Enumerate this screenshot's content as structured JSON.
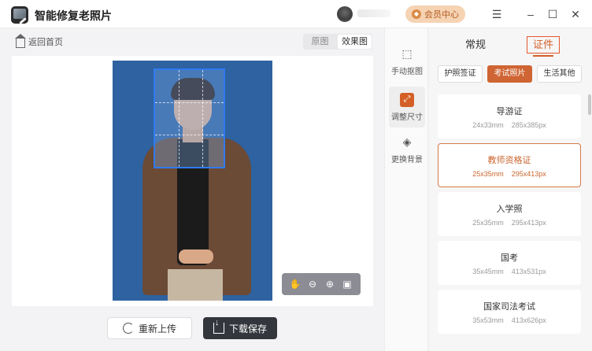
{
  "app": {
    "title": "智能修复老照片"
  },
  "header": {
    "vip_label": "会员中心",
    "vip_icon": "diamond-icon",
    "menu_icon": "hamburger-menu-icon",
    "minimize_icon": "minimize-icon",
    "maximize_icon": "maximize-icon",
    "close_icon": "close-icon"
  },
  "left": {
    "back_label": "返回首页",
    "view_options": [
      "原图",
      "效果图"
    ],
    "active_view": "效果图",
    "zoom_tools": [
      "hand-icon",
      "zoom-out-icon",
      "zoom-in-icon",
      "fit-icon"
    ],
    "reupload_label": "重新上传",
    "download_label": "下载保存"
  },
  "tools": [
    {
      "label": "手动抠图",
      "icon": "cursor-select-icon",
      "active": false
    },
    {
      "label": "调整尺寸",
      "icon": "resize-icon",
      "active": true
    },
    {
      "label": "更换背景",
      "icon": "paint-bucket-icon",
      "active": false
    }
  ],
  "panel": {
    "tabs": [
      "常规",
      "证件"
    ],
    "active_tab": "证件",
    "subtabs": [
      "护照签证",
      "考试照片",
      "生活其他"
    ],
    "active_subtab": "考试照片",
    "cards": [
      {
        "name": "导游证",
        "mm": "24x33mm",
        "px": "285x385px",
        "active": false
      },
      {
        "name": "教师资格证",
        "mm": "25x35mm",
        "px": "295x413px",
        "active": true
      },
      {
        "name": "入学照",
        "mm": "25x35mm",
        "px": "295x413px",
        "active": false
      },
      {
        "name": "国考",
        "mm": "35x45mm",
        "px": "413x531px",
        "active": false
      },
      {
        "name": "国家司法考试",
        "mm": "35x53mm",
        "px": "413x626px",
        "active": false
      }
    ]
  },
  "colors": {
    "accent": "#d35f27",
    "photo_background": "#2e62a0",
    "crop_border": "#2f7bf0"
  }
}
